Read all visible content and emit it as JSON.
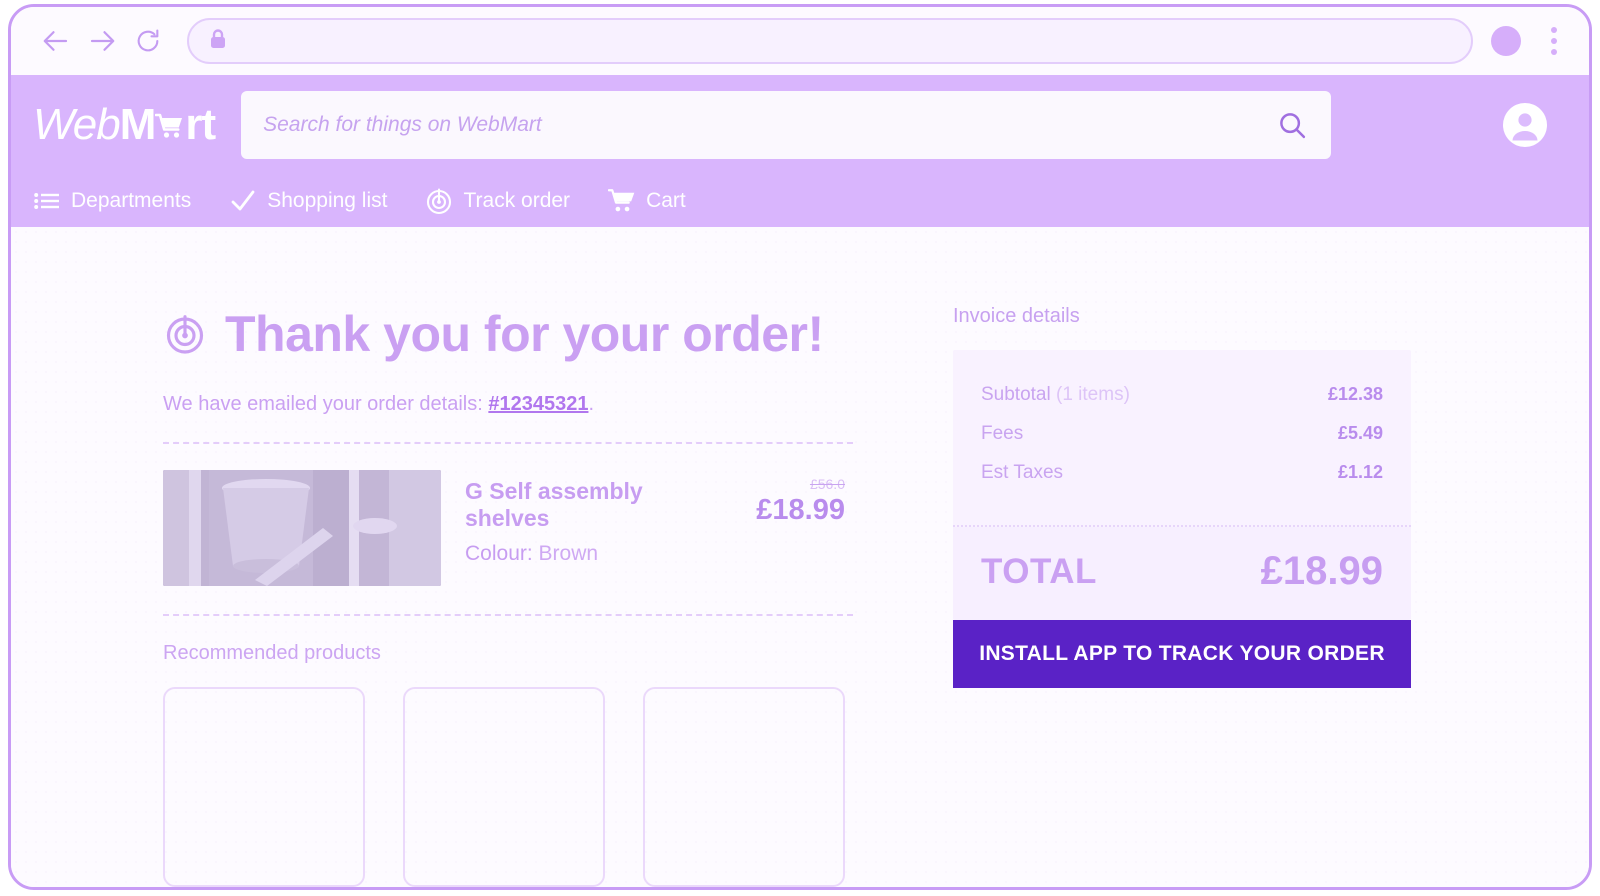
{
  "browser": {
    "back_icon": "back-arrow-icon",
    "forward_icon": "forward-arrow-icon",
    "reload_icon": "reload-icon",
    "lock_icon": "lock-icon",
    "url_value": "",
    "profile_icon": "profile-avatar-icon",
    "menu_icon": "kebab-menu-icon"
  },
  "header": {
    "brand": {
      "part1": "Web",
      "part2": "M",
      "cart_glyph": "cart-icon",
      "part3": "rt"
    },
    "search": {
      "value": "",
      "placeholder": "Search for things on WebMart",
      "icon": "search-icon"
    },
    "account_icon": "account-circle-icon",
    "nav": [
      {
        "label": "Departments",
        "icon": "list-menu-icon"
      },
      {
        "label": "Shopping list",
        "icon": "check-icon"
      },
      {
        "label": "Track order",
        "icon": "radar-target-icon"
      },
      {
        "label": "Cart",
        "icon": "shopping-cart-icon"
      }
    ]
  },
  "main": {
    "heading_icon": "radar-target-icon",
    "heading": "Thank you for your order!",
    "email_prefix": "We have emailed your order details: ",
    "order_number": "#12345321",
    "email_suffix": ".",
    "product": {
      "image_alt": "self-assembly-shelves-photo",
      "title": "G Self assembly shelves",
      "colour_label": "Colour:",
      "colour_value": "Brown",
      "price_was": "£56.0",
      "price_now": "£18.99"
    },
    "recommended_title": "Recommended products",
    "recommended_cards": [
      {
        "id": "rec-card-1"
      },
      {
        "id": "rec-card-2"
      },
      {
        "id": "rec-card-3"
      }
    ]
  },
  "invoice": {
    "label": "Invoice details",
    "rows": [
      {
        "label": "Subtotal",
        "sublabel": " (1 items)",
        "value": "£12.38"
      },
      {
        "label": "Fees",
        "sublabel": "",
        "value": "£5.49"
      },
      {
        "label": "Est Taxes",
        "sublabel": "",
        "value": "£1.12"
      }
    ],
    "total_label": "TOTAL",
    "total_value": "£18.99",
    "cta_label": "INSTALL APP TO TRACK YOUR ORDER"
  },
  "colors": {
    "brand_purple": "#d9b5fd",
    "accent_light": "#caa0f2",
    "cta_purple": "#5a22c6",
    "page_bg": "#fdfbff"
  }
}
